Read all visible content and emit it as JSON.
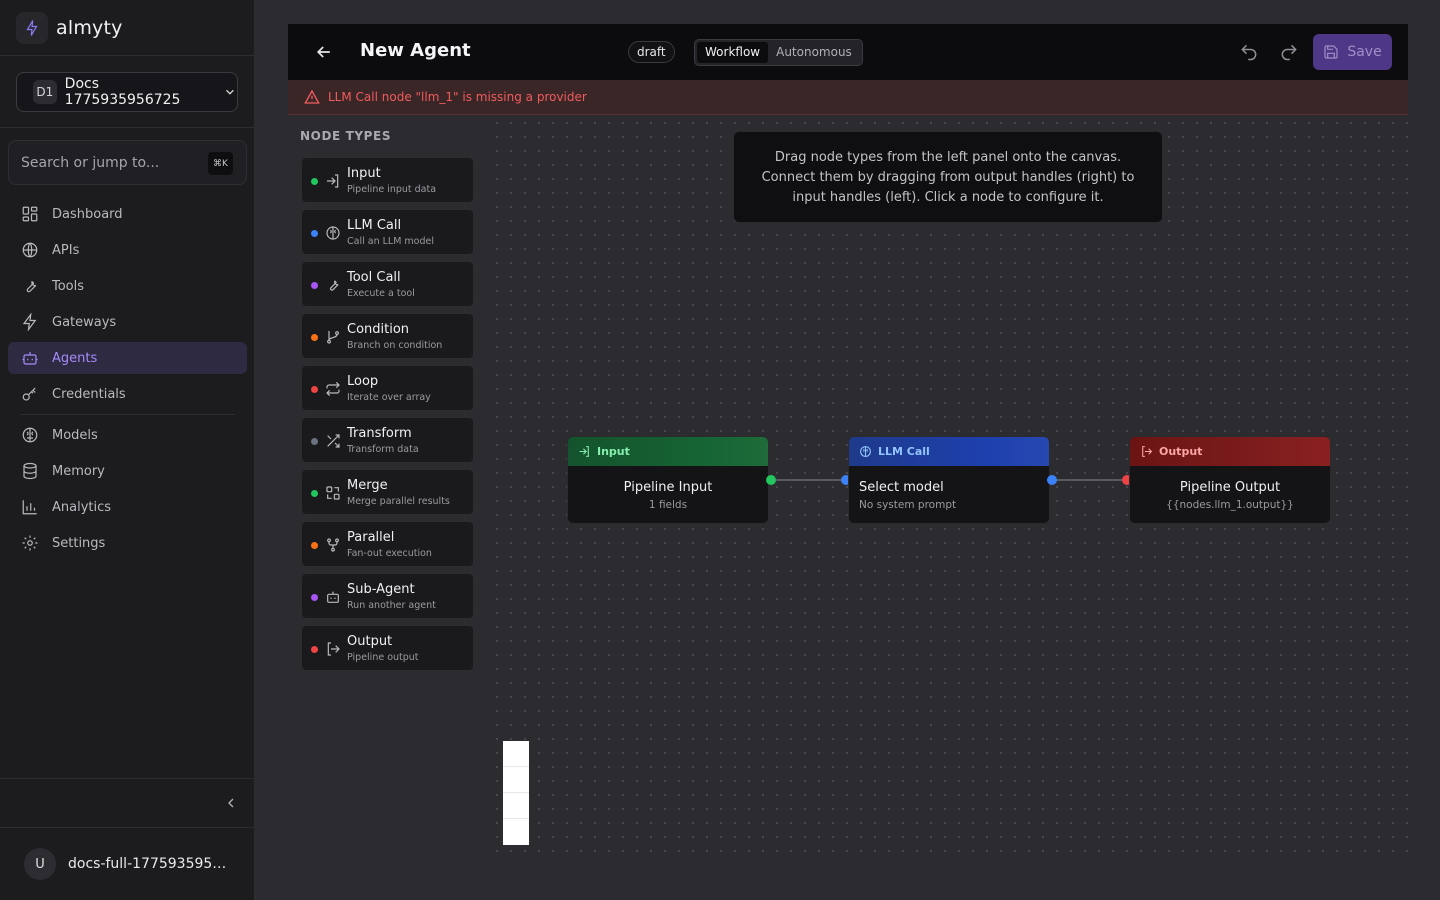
{
  "brand": {
    "name": "almyty"
  },
  "workspace": {
    "badge": "D1",
    "name": "Docs 1775935956725"
  },
  "search": {
    "placeholder": "Search or jump to...",
    "shortcut": "⌘K"
  },
  "nav": [
    {
      "label": "Dashboard",
      "icon": "dashboard-icon"
    },
    {
      "label": "APIs",
      "icon": "globe-icon"
    },
    {
      "label": "Tools",
      "icon": "wrench-icon"
    },
    {
      "label": "Gateways",
      "icon": "bolt-icon"
    },
    {
      "label": "Agents",
      "icon": "bot-icon",
      "active": true
    },
    {
      "label": "Credentials",
      "icon": "key-icon"
    },
    {
      "label": "Models",
      "icon": "brain-icon"
    },
    {
      "label": "Memory",
      "icon": "database-icon"
    },
    {
      "label": "Analytics",
      "icon": "bar-chart-icon"
    },
    {
      "label": "Settings",
      "icon": "gear-icon"
    }
  ],
  "user": {
    "initial": "U",
    "name": "docs-full-1775935956..."
  },
  "editor": {
    "title": "New Agent",
    "status": "draft",
    "modes": [
      "Workflow",
      "Autonomous"
    ],
    "active_mode": "Workflow",
    "save_label": "Save",
    "error": "LLM Call node \"llm_1\" is missing a provider"
  },
  "palette": {
    "title": "NODE TYPES",
    "items": [
      {
        "name": "Input",
        "desc": "Pipeline input data",
        "color": "#22c55e"
      },
      {
        "name": "LLM Call",
        "desc": "Call an LLM model",
        "color": "#3b82f6"
      },
      {
        "name": "Tool Call",
        "desc": "Execute a tool",
        "color": "#a855f7"
      },
      {
        "name": "Condition",
        "desc": "Branch on condition",
        "color": "#f97316"
      },
      {
        "name": "Loop",
        "desc": "Iterate over array",
        "color": "#ef4444"
      },
      {
        "name": "Transform",
        "desc": "Transform data",
        "color": "#6b7280"
      },
      {
        "name": "Merge",
        "desc": "Merge parallel results",
        "color": "#22c55e"
      },
      {
        "name": "Parallel",
        "desc": "Fan-out execution",
        "color": "#f97316"
      },
      {
        "name": "Sub-Agent",
        "desc": "Run another agent",
        "color": "#a855f7"
      },
      {
        "name": "Output",
        "desc": "Pipeline output",
        "color": "#ef4444"
      }
    ]
  },
  "hint": {
    "lines": [
      "Drag node types from the left panel onto the canvas.",
      "Connect them by dragging from output handles (right) to",
      "input handles (left). Click a node to configure it."
    ]
  },
  "nodes": {
    "input": {
      "type": "Input",
      "title": "Pipeline Input",
      "sub": "1 fields",
      "color": "#22c55e"
    },
    "llm": {
      "type": "LLM Call",
      "title": "Select model",
      "sub": "No system prompt",
      "color": "#3b82f6"
    },
    "output": {
      "type": "Output",
      "title": "Pipeline Output",
      "sub": "{{nodes.llm_1.output}}",
      "color": "#ef4444"
    }
  },
  "colors": {
    "accent": "#a78bfa",
    "error": "#f05c5c",
    "save": "#5b3f9e"
  }
}
